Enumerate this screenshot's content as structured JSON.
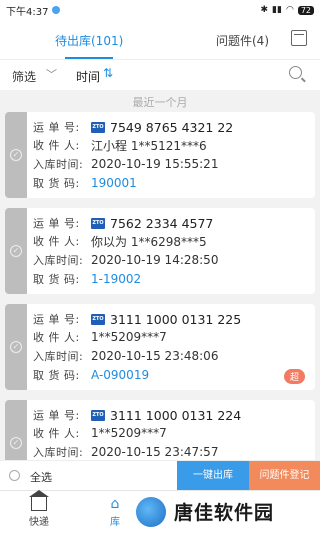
{
  "status": {
    "time": "下午4:37",
    "battery": "72"
  },
  "tabs": {
    "active": "待出库(101)",
    "other": "问题件(4)"
  },
  "filter": {
    "label": "筛选",
    "time_label": "时间",
    "sort_glyph": "⇅"
  },
  "section_label": "最近一个月",
  "labels": {
    "waybill": "运 单 号:",
    "receiver": "收 件 人:",
    "intime": "入库时间:",
    "code": "取 货 码:"
  },
  "cards": [
    {
      "waybill": "7549 8765 4321 22",
      "receiver": "江小程 1**5121***6",
      "intime": "2020-10-19 15:55:21",
      "code": "190001",
      "overdue": ""
    },
    {
      "waybill": "7562 2334 4577",
      "receiver": "你以为 1**6298***5",
      "intime": "2020-10-19 14:28:50",
      "code": "1-19002",
      "overdue": ""
    },
    {
      "waybill": "3111 1000 0131 225",
      "receiver": "1**5209***7",
      "intime": "2020-10-15 23:48:06",
      "code": "A-090019",
      "overdue": "超"
    },
    {
      "waybill": "3111 1000 0131 224",
      "receiver": "1**5209***7",
      "intime": "2020-10-15 23:47:57",
      "code": "",
      "overdue": ""
    }
  ],
  "courier_badge": "ZTO",
  "bottom": {
    "select_all": "全选",
    "checkout": "一键出库",
    "issue": "问题件登记"
  },
  "nav": {
    "home": "快递",
    "store": "库"
  },
  "watermark": "唐佳软件园",
  "colors": {
    "accent": "#1e8ce0",
    "issue": "#f28a5b",
    "overdue": "#f27b62"
  }
}
